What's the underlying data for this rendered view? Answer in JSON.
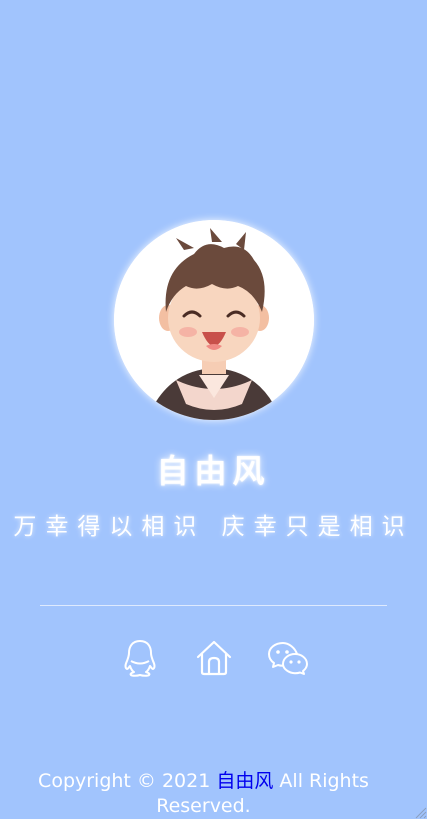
{
  "profile": {
    "name": "自由风",
    "motto": "万幸得以相识 庆幸只是相识"
  },
  "social": [
    {
      "icon": "qq-icon"
    },
    {
      "icon": "home-icon"
    },
    {
      "icon": "wechat-icon"
    }
  ],
  "footer": {
    "prefix": "Copyright © 2021 ",
    "link_text": "自由风",
    "suffix": " All Rights Reserved."
  },
  "colors": {
    "background": "#a1c4fd",
    "text": "#ffffff",
    "footer_link": "#0000ee"
  }
}
